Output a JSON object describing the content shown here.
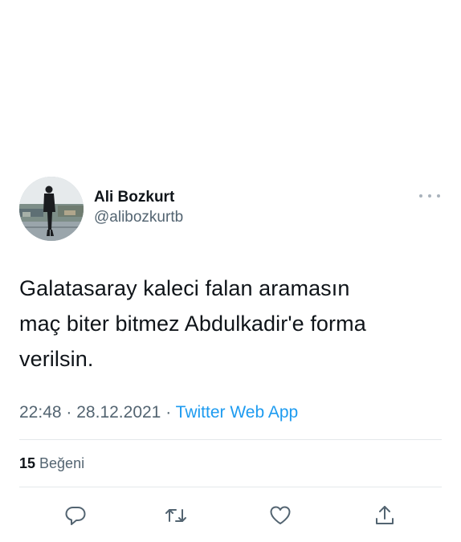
{
  "tweet": {
    "author": {
      "display_name": "Ali Bozkurt",
      "handle": "@alibozkurtb"
    },
    "text_lines": [
      "Galatasaray kaleci falan aramasın",
      "maç biter bitmez Abdulkadir'e forma",
      "verilsin."
    ],
    "time": "22:48",
    "separator": "·",
    "date": "28.12.2021",
    "source": "Twitter Web App",
    "likes": {
      "count": "15",
      "label": "Beğeni"
    },
    "action_icons": [
      "reply-icon",
      "retweet-icon",
      "like-icon",
      "share-icon"
    ]
  },
  "colors": {
    "text": "#0f1419",
    "secondary": "#536471",
    "link": "#1d9bf0",
    "divider": "#e4e8eb"
  }
}
